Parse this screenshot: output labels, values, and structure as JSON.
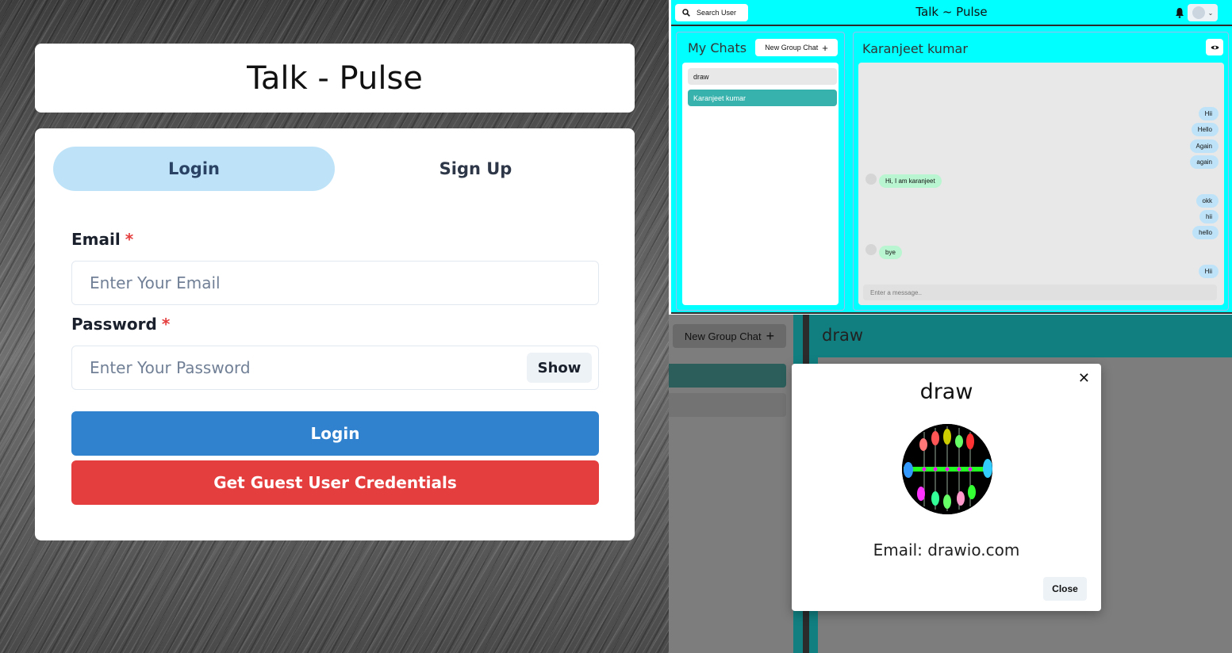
{
  "login_page": {
    "title": "Talk - Pulse",
    "tabs": [
      {
        "label": "Login"
      },
      {
        "label": "Sign Up"
      }
    ],
    "email": {
      "label": "Email",
      "required_mark": "*",
      "placeholder": "Enter Your Email",
      "value": ""
    },
    "password": {
      "label": "Password",
      "required_mark": "*",
      "placeholder": "Enter Your Password",
      "value": "",
      "show_label": "Show"
    },
    "login_button": "Login",
    "guest_button": "Get Guest User Credentials",
    "colors": {
      "tab_active": "#bee3f8",
      "login_button": "#3182ce",
      "guest_button": "#e53e3e"
    }
  },
  "chat_app": {
    "search_label": "Search User",
    "title": "Talk ~ Pulse",
    "my_chats": {
      "title": "My Chats",
      "new_group_label": "New Group Chat",
      "items": [
        {
          "name": "draw"
        },
        {
          "name": "Karanjeet kumar"
        }
      ]
    },
    "chat": {
      "name": "Karanjeet kumar",
      "messages": [
        {
          "text": "Hii",
          "from": "me"
        },
        {
          "text": "Hello",
          "from": "me"
        },
        {
          "text": "Again",
          "from": "me"
        },
        {
          "text": "again",
          "from": "me"
        },
        {
          "text": "Hi, I am karanjeet",
          "from": "them"
        },
        {
          "text": "okk",
          "from": "me"
        },
        {
          "text": "hii",
          "from": "me"
        },
        {
          "text": "hello",
          "from": "me"
        },
        {
          "text": "bye",
          "from": "them"
        },
        {
          "text": "Hii",
          "from": "me"
        }
      ],
      "input_placeholder": "Enter a message.."
    },
    "colors": {
      "accent": "#00ffff",
      "selected_chat": "#38b2ac",
      "my_bubble": "#bee3f8",
      "their_bubble": "#b9f5d0"
    }
  },
  "group_view": {
    "new_group_label": "New Group Chat",
    "title": "draw",
    "modal": {
      "title": "draw",
      "email": "Email: drawio.com",
      "close_label": "Close"
    }
  }
}
